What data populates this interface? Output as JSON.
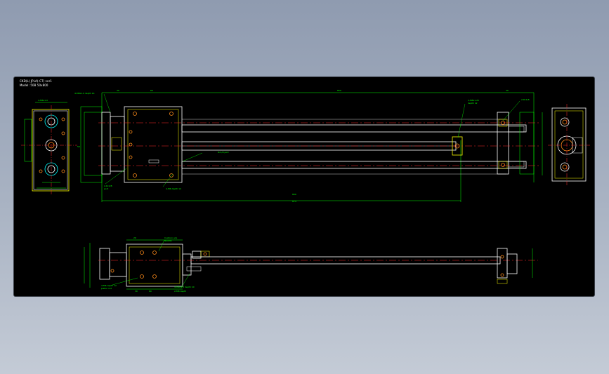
{
  "drawing": {
    "title_line1": "CKD(L) JPLA(-CT) ver1",
    "title_line2": "Model: 50B 50x800"
  },
  "dimensions": {
    "top_view_total": "800",
    "top_view_stroke": "800",
    "top_view_overall": "874",
    "side_view_width": "50",
    "end_width_a": "30",
    "end_width_b": "60",
    "end_width_c": "30",
    "bottom_a": "20",
    "bottom_b": "60",
    "bottom_c": "30"
  },
  "notes": {
    "top_left_note": "4-M8x1.0 depth 14",
    "top_right_note_a": "2-M8x1.25",
    "top_right_note_b": "depth 12",
    "top_right_note_c": "2-Rc1/8",
    "bottom_left_note_a": "2-Rc1/8",
    "bottom_left_note_b": "port",
    "mid_note": "4-M6 depth 12",
    "mid_note2": "Rc1/8 port",
    "side_note_a": "Cushion adj.",
    "side_note_b": "Needle",
    "side_note_c": "4-M6 depth 12",
    "side_note_d": "4-M6x1.0 depth 10",
    "side_note_e": "piston rod",
    "side_note_f": "2-M8 depth",
    "left_small": "4-M6x1.0"
  },
  "colors": {
    "geometry": "#ffffff",
    "dimension": "#00ff00",
    "center_line": "#ff2a2a",
    "hidden": "#ffff00",
    "hole": "#ff8c1a",
    "background": "#000000"
  }
}
